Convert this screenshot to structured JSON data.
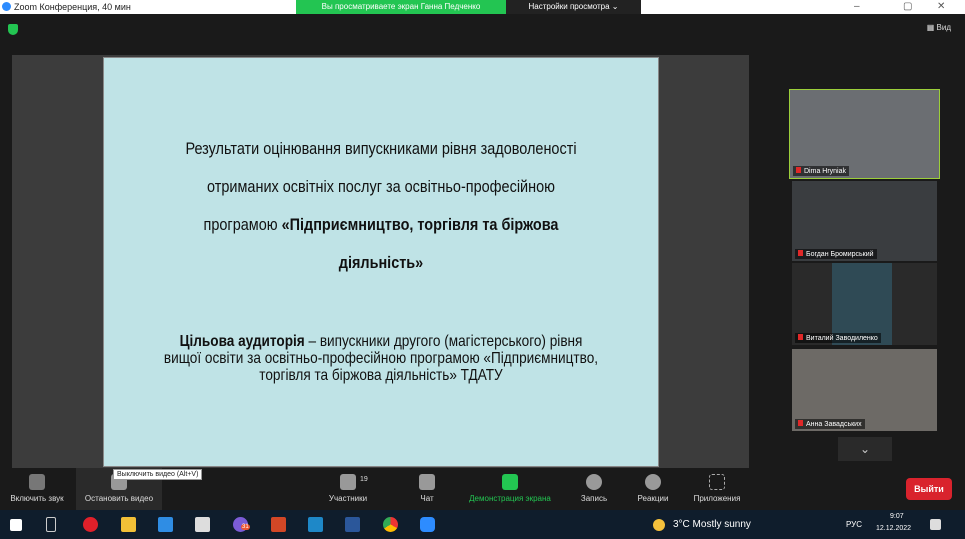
{
  "window": {
    "title": "Zoom Конференция, 40 мин",
    "viewing_banner": "Вы просматриваете экран Ганна Педченко",
    "view_settings": "Настройки просмотра ⌄",
    "minimize": "–",
    "maximize": "▢",
    "close": "✕"
  },
  "header": {
    "view_label": "▦ Вид"
  },
  "slide": {
    "title_lines": [
      "Результати оцінювання випускниками рівня задоволеності",
      "отриманих освітніх послуг за освітньо-професійною",
      "програмою "
    ],
    "title_bold": "«Підприємництво, торгівля та біржова діяльність»",
    "audience_bold": "Цільова аудиторія",
    "audience_text": " – випускники другого (магістерського) рівня вищої освіти за  освітньо-професійною програмою «Підприємництво, торгівля та біржова діяльність» ТДАТУ"
  },
  "participants": [
    {
      "name": "Dima Hryniak"
    },
    {
      "name": "Богдан Бромирський"
    },
    {
      "name": "Виталий Заводиленко"
    },
    {
      "name": "Анна Завадських"
    }
  ],
  "more_chevron": "⌄",
  "toolbar": {
    "tooltip": "Выключить видео (Alt+V)",
    "items": [
      {
        "label": "Включить звук"
      },
      {
        "label": "Остановить видео"
      },
      {
        "label": "Участники",
        "count": "19"
      },
      {
        "label": "Чат"
      },
      {
        "label": "Демонстрация экрана"
      },
      {
        "label": "Запись"
      },
      {
        "label": "Реакции"
      },
      {
        "label": "Приложения"
      }
    ],
    "leave": "Выйти"
  },
  "taskbar": {
    "weather": "3°C  Mostly sunny",
    "lang": "РУС",
    "time": "9:07",
    "date": "12.12.2022",
    "badge": "31"
  },
  "colors": {
    "green": "#23c552",
    "red": "#d9232d",
    "slide_bg": "#bfe3e6"
  }
}
